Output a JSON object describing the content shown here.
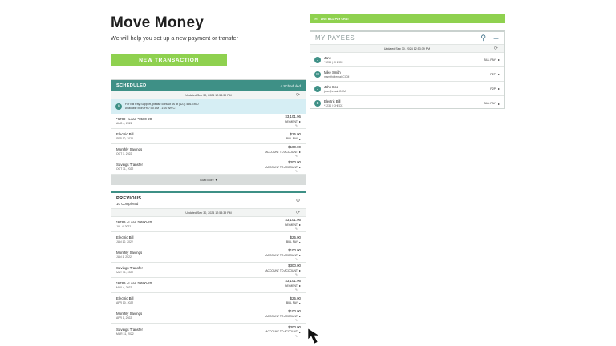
{
  "page": {
    "title": "Move Money",
    "subtitle": "We will help you set up a new payment or transfer",
    "new_transaction_label": "NEW TRANSACTION"
  },
  "scheduled": {
    "title": "SCHEDULED",
    "count_label": "4 Scheduled",
    "updated": "Updated Sep 30, 2024 12:53:39 PM",
    "info": {
      "line1": "For Bill Pay Support, please contact us at (123) 456-7890",
      "line2": "Available Mon-Fri 7:00 AM - 1:00 Am CT"
    },
    "items": [
      {
        "name": "*6789 - Loan *0500-20",
        "date": "AUG 4, 2022",
        "amount": "$3,101.96",
        "type": "PAYMENT"
      },
      {
        "name": "Electric Bill",
        "date": "SEP 10, 2022",
        "amount": "$25.00",
        "type": "BILL PAY"
      },
      {
        "name": "Monthly Savings",
        "date": "OCT 1, 2022",
        "amount": "$100.00",
        "type": "ACCOUNT TO ACCOUNT"
      },
      {
        "name": "Savings Transfer",
        "date": "OCT 31, 2022",
        "amount": "$300.00",
        "type": "ACCOUNT TO ACCOUNT"
      }
    ],
    "load_more_label": "Load More"
  },
  "previous": {
    "title": "PREVIOUS",
    "count_label": "10 Completed",
    "updated": "Updated Sep 30, 2024 12:53:39 PM",
    "items": [
      {
        "name": "*6789 - Loan *0500-20",
        "date": "JUL 4, 2022",
        "amount": "$3,101.96",
        "type": "PAYMENT"
      },
      {
        "name": "Electric Bill",
        "date": "JUN 10, 2022",
        "amount": "$25.00",
        "type": "BILL PAY"
      },
      {
        "name": "Monthly Savings",
        "date": "JUN 1, 2022",
        "amount": "$100.00",
        "type": "ACCOUNT TO ACCOUNT"
      },
      {
        "name": "Savings Transfer",
        "date": "MAY 31, 2022",
        "amount": "$300.00",
        "type": "ACCOUNT TO ACCOUNT"
      },
      {
        "name": "*6789 - Loan *0500-20",
        "date": "MAY 4, 2022",
        "amount": "$3,101.96",
        "type": "PAYMENT"
      },
      {
        "name": "Electric Bill",
        "date": "APR 10, 2022",
        "amount": "$25.00",
        "type": "BILL PAY"
      },
      {
        "name": "Monthly Savings",
        "date": "APR 1, 2022",
        "amount": "$100.00",
        "type": "ACCOUNT TO ACCOUNT"
      },
      {
        "name": "Savings Transfer",
        "date": "MAR 31, 2022",
        "amount": "$300.00",
        "type": "ACCOUNT TO ACCOUNT"
      }
    ]
  },
  "payees": {
    "top_bar_label": "LIVE BILL PAY CHAT",
    "title": "MY PAYEES",
    "updated": "Updated Sep 30, 2024 12:53:39 PM",
    "items": [
      {
        "initial": "J",
        "name": "Jane",
        "sub": "*1234 | CHECK",
        "method": "BILL PAY"
      },
      {
        "initial": "M",
        "name": "Mike Smith",
        "sub": "msmith@email.COM",
        "method": "P2P"
      },
      {
        "initial": "J",
        "name": "John Doe",
        "sub": "jdoe@email.COM",
        "method": "P2P"
      },
      {
        "initial": "E",
        "name": "Electric Bill",
        "sub": "*1234 | CHECK",
        "method": "BILL PAY"
      }
    ]
  },
  "colors": {
    "green_accent": "#8fd14f",
    "teal_header": "#3e9086",
    "info_bg": "#d6eef4"
  }
}
